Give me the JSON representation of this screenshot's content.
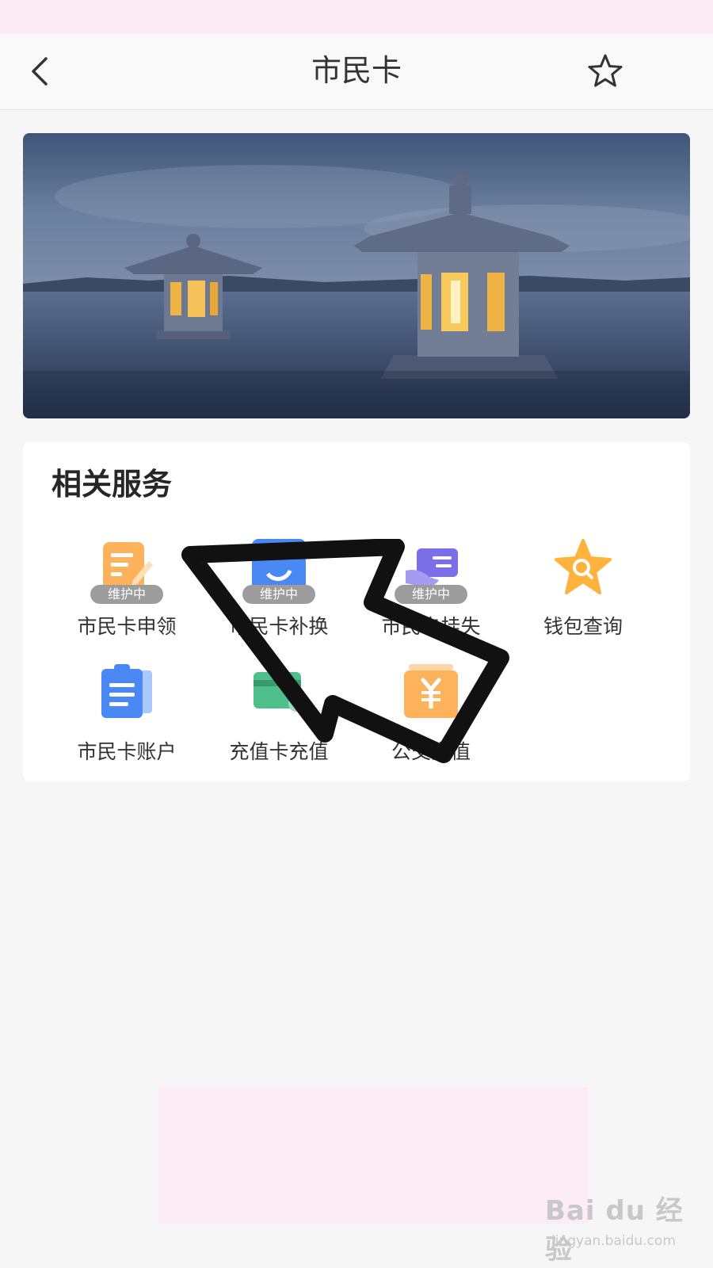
{
  "nav": {
    "title": "市民卡"
  },
  "section": {
    "title": "相关服务"
  },
  "services": [
    {
      "label": "市民卡申领",
      "badge": "维护中"
    },
    {
      "label": "市民卡补换",
      "badge": "维护中"
    },
    {
      "label": "市民卡挂失",
      "badge": "维护中"
    },
    {
      "label": "钱包查询"
    },
    {
      "label": "市民卡账户"
    },
    {
      "label": "充值卡充值"
    },
    {
      "label": "公交充值"
    }
  ],
  "watermark": {
    "brand": "Bai du 经验",
    "url": "jingyan.baidu.com"
  },
  "colors": {
    "orange": "#ffb25c",
    "blue": "#4a89f3",
    "purple": "#7b6fe8",
    "green": "#4fbf8c",
    "badge": "#9c9c9c"
  }
}
